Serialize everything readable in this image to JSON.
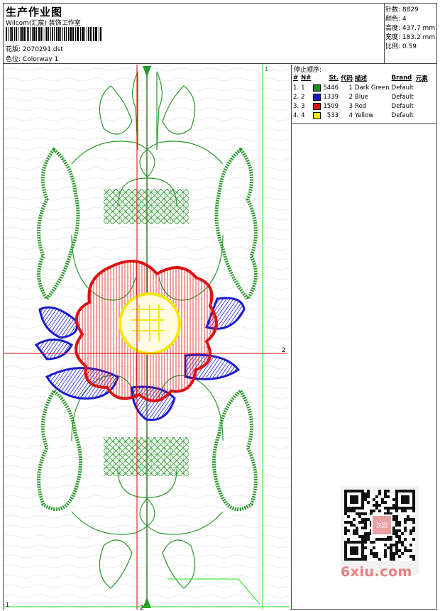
{
  "header": {
    "title": "生产作业图",
    "company": "Wilcom(汇宸) 装饰工作室",
    "design_label": "花版:",
    "design_value": "2070291.dst",
    "colorway_label": "色位:",
    "colorway_value": "Colorway 1"
  },
  "stats": [
    {
      "label": "针数:",
      "value": "8829"
    },
    {
      "label": "颜色:",
      "value": "4"
    },
    {
      "label": "高度:",
      "value": "437.7 mm"
    },
    {
      "label": "宽度:",
      "value": "183.2 mm"
    },
    {
      "label": "比例:",
      "value": "0.59"
    }
  ],
  "stop_sequence": {
    "title": "停止顺序:",
    "columns": [
      "#",
      "N#",
      "St.",
      "代码",
      "描述",
      "Brand",
      "元素"
    ],
    "rows": [
      {
        "idx": "1.",
        "n": "1",
        "color": "#1f8a1f",
        "stitches": "5446",
        "code": "1",
        "desc": "Dark Green",
        "brand": "Default"
      },
      {
        "idx": "2.",
        "n": "2",
        "color": "#1a1acc",
        "stitches": "1339",
        "code": "2",
        "desc": "Blue",
        "brand": "Default"
      },
      {
        "idx": "3.",
        "n": "3",
        "color": "#dd1111",
        "stitches": "1509",
        "code": "3",
        "desc": "Red",
        "brand": "Default"
      },
      {
        "idx": "4.",
        "n": "4",
        "color": "#f5e800",
        "stitches": "533",
        "code": "4",
        "desc": "Yellow",
        "brand": "Default"
      }
    ]
  },
  "canvas": {
    "marker_1_top": "1",
    "marker_2_right": "2",
    "marker_1_bottom": "1",
    "marker_2_bottom": "2"
  },
  "watermark": {
    "text": "6xiu.com",
    "qr_logo": "汉园"
  },
  "colors": {
    "green": "#2a9a2a",
    "blue": "#1a1acc",
    "red": "#dd1111",
    "yellow": "#f5e800",
    "guide_red": "#e00000",
    "guide_green": "#22dd22"
  }
}
